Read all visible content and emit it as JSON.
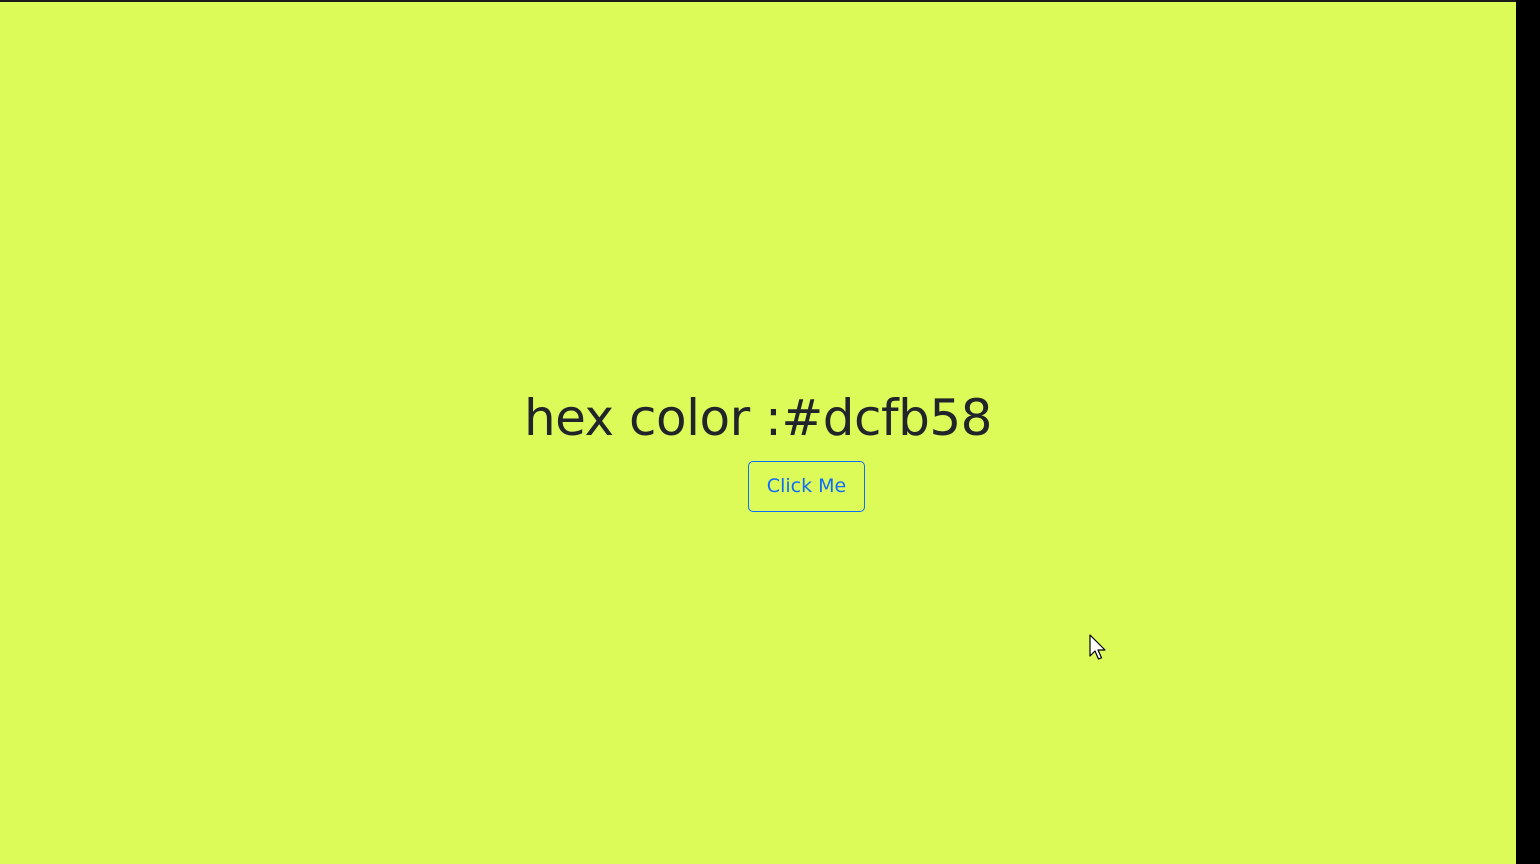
{
  "page": {
    "background_color": "#dcfb58",
    "heading_text": "hex color :#dcfb58",
    "button_label": "Click Me",
    "button_color": "#0d6efd",
    "text_color": "#212529"
  },
  "icons": {
    "cursor": "mouse-pointer-icon"
  }
}
